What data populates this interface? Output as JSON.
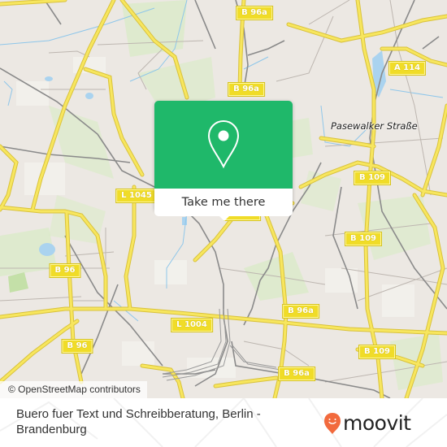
{
  "map": {
    "colors": {
      "land": "#ece8e3",
      "park": "#d6ecc0",
      "water": "#aad3ef",
      "major_road": "#f5e35a",
      "road_casing": "#d9c23c",
      "rail": "#8c8c8c",
      "minor_road": "#bdb6b0"
    },
    "road_shields": [
      {
        "id": "b96a-top",
        "label": "B 96a"
      },
      {
        "id": "b96a-upper",
        "label": "B 96a"
      },
      {
        "id": "a114",
        "label": "A 114"
      },
      {
        "id": "l1045",
        "label": "L 1045"
      },
      {
        "id": "b96a-center",
        "label": "B 96a"
      },
      {
        "id": "b109-upper",
        "label": "B 109"
      },
      {
        "id": "b109-mid",
        "label": "B 109"
      },
      {
        "id": "b96-left",
        "label": "B 96"
      },
      {
        "id": "b96a-right",
        "label": "B 96a"
      },
      {
        "id": "l1004",
        "label": "L 1004"
      },
      {
        "id": "b96-lower",
        "label": "B 96"
      },
      {
        "id": "b109-lower",
        "label": "B 109"
      },
      {
        "id": "b96a-bottom",
        "label": "B 96a"
      }
    ],
    "place_labels": [
      {
        "id": "pasewalker-strasse",
        "label": "Pasewalker Straße"
      }
    ],
    "attribution": "© OpenStreetMap contributors"
  },
  "popup": {
    "icon": "map-pin-icon",
    "accent": "#1fb86a",
    "action_label": "Take me there"
  },
  "footer": {
    "place_title": "Buero fuer Text und Schreibberatung, Berlin - Brandenburg",
    "brand": {
      "name": "moovit",
      "icon": "moovit-pin-smile-icon",
      "accent": "#f26a3d"
    }
  }
}
